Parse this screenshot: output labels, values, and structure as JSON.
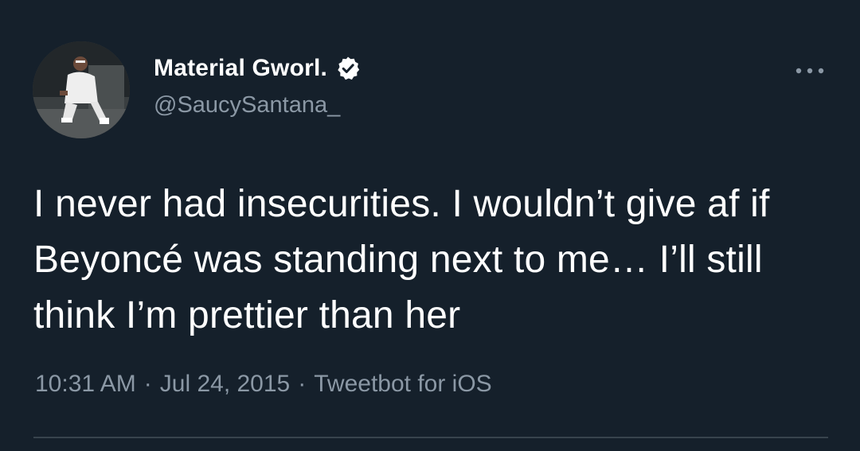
{
  "tweet": {
    "author": {
      "display_name": "Material Gworl.",
      "handle": "@SaucySantana_",
      "verified": true
    },
    "text": "I never had insecurities. I wouldn’t give af if Beyoncé was standing next to me… I’ll still think I’m prettier than her",
    "time": "10:31 AM",
    "date": "Jul 24, 2015",
    "source": "Tweetbot for iOS",
    "separator": "·"
  },
  "icons": {
    "verified": "verified-badge-icon",
    "more": "more-options-icon"
  },
  "colors": {
    "background": "#15202b",
    "primary_text": "#ffffff",
    "secondary_text": "#8b98a5",
    "divider": "#38444d"
  }
}
